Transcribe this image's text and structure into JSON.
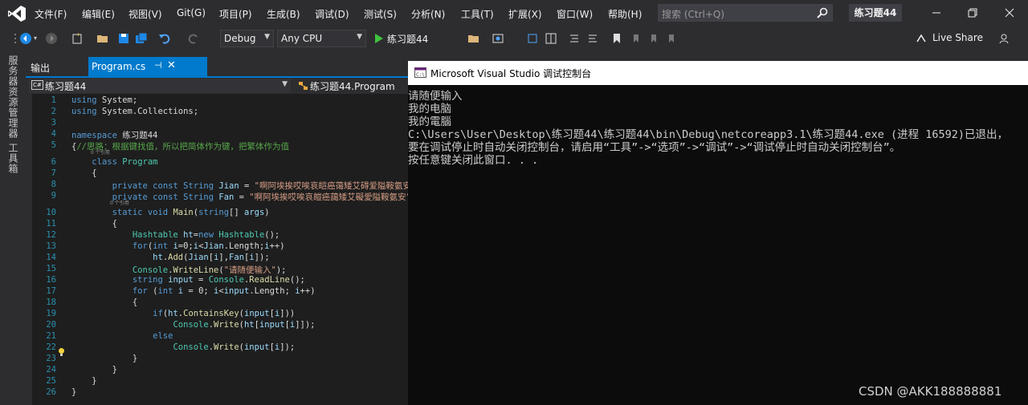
{
  "menu": [
    "文件(F)",
    "编辑(E)",
    "视图(V)",
    "Git(G)",
    "项目(P)",
    "生成(B)",
    "调试(D)",
    "测试(S)",
    "分析(N)",
    "工具(T)",
    "扩展(X)",
    "窗口(W)",
    "帮助(H)"
  ],
  "search": {
    "placeholder": "搜索 (Ctrl+Q)"
  },
  "solution_title": "练习题44",
  "toolbar": {
    "config": "Debug",
    "platform": "Any CPU",
    "run_label": "练习题44",
    "live_share": "Live Share"
  },
  "side_tools": {
    "server_explorer": "服务器资源管理器",
    "toolbox": "工具箱"
  },
  "tabs": {
    "output": "输出",
    "program": "Program.cs",
    "pin": "⊣",
    "close": "✕"
  },
  "navbar": {
    "project_icon": "C#",
    "project": "练习题44",
    "class": "练习题44.Program"
  },
  "hints": {
    "ref0": "0 个引用",
    "ref0b": "0 个引用"
  },
  "code_lines": [
    {
      "n": "1",
      "html": "<span class='kw'>using</span> System;"
    },
    {
      "n": "2",
      "html": "<span class='kw'>using</span> System.Collections;"
    },
    {
      "n": "3",
      "html": ""
    },
    {
      "n": "4",
      "html": "<span class='kw'>namespace</span> 练习题44"
    },
    {
      "n": "5",
      "html": "{<span class='cm'>//思路：根据键找值，所以把简体作为键，把繁体作为值</span>"
    },
    {
      "n": "6",
      "html": "    <span class='kw'>class</span> <span class='ty'>Program</span>"
    },
    {
      "n": "7",
      "html": "    {"
    },
    {
      "n": "8",
      "html": "        <span class='kw'>private</span> <span class='kw'>const</span> <span class='kw'>String</span> <span class='vr'>Jian</span> = <span class='str'>\"啊阿埃挨哎唉哀皑癌蔼矮艾碍爱隘鞍氨安\"</span>"
    },
    {
      "n": "9",
      "html": "        <span class='kw'>private</span> <span class='kw'>const</span> <span class='kw'>String</span> <span class='vr'>Fan</span> = <span class='str'>\"啊阿埃挨哎唉哀皚癌藹矮艾礙愛隘鞍氨安\"</span>"
    },
    {
      "n": "10",
      "html": "        <span class='kw'>static</span> <span class='kw'>void</span> <span class='mt'>Main</span>(<span class='kw'>string</span>[] <span class='vr'>args</span>)"
    },
    {
      "n": "11",
      "html": "        {"
    },
    {
      "n": "12",
      "html": "            <span class='ty'>Hashtable</span> <span class='vr'>ht</span>=<span class='kw'>new</span> <span class='ty'>Hashtable</span>();"
    },
    {
      "n": "13",
      "html": "            <span class='kw'>for</span>(<span class='kw'>int</span> <span class='vr'>i</span>=0;<span class='vr'>i</span>&lt;<span class='vr'>Jian</span>.Length;<span class='vr'>i</span>++)"
    },
    {
      "n": "14",
      "html": "                <span class='vr'>ht</span>.<span class='mt'>Add</span>(<span class='vr'>Jian</span>[<span class='vr'>i</span>],<span class='vr'>Fan</span>[<span class='vr'>i</span>]);"
    },
    {
      "n": "15",
      "html": "            <span class='ty'>Console</span>.<span class='mt'>WriteLine</span>(<span class='str'>\"请随便输入\"</span>);"
    },
    {
      "n": "16",
      "html": "            <span class='kw'>string</span> <span class='vr'>input</span> = <span class='ty'>Console</span>.<span class='mt'>ReadLine</span>();"
    },
    {
      "n": "17",
      "html": "            <span class='kw'>for</span> (<span class='kw'>int</span> <span class='vr'>i</span> = 0; <span class='vr'>i</span>&lt;<span class='vr'>input</span>.Length; <span class='vr'>i</span>++)"
    },
    {
      "n": "18",
      "html": "            {"
    },
    {
      "n": "19",
      "html": "                <span class='kw'>if</span>(<span class='vr'>ht</span>.<span class='mt'>ContainsKey</span>(<span class='vr'>input</span>[<span class='vr'>i</span>]))"
    },
    {
      "n": "20",
      "html": "                    <span class='ty'>Console</span>.<span class='mt'>Write</span>(<span class='vr'>ht</span>[<span class='vr'>input</span>[<span class='vr'>i</span>]]);"
    },
    {
      "n": "21",
      "html": "                <span class='kw'>else</span>"
    },
    {
      "n": "22",
      "html": "                    <span class='ty'>Console</span>.<span class='mt'>Write</span>(<span class='vr'>input</span>[<span class='vr'>i</span>]);"
    },
    {
      "n": "23",
      "html": "            }"
    },
    {
      "n": "24",
      "html": "        }"
    },
    {
      "n": "25",
      "html": "    }"
    },
    {
      "n": "26",
      "html": "}"
    }
  ],
  "console": {
    "title": "Microsoft Visual Studio 调试控制台",
    "lines": [
      "请随便输入",
      "我的电脑",
      "我的電腦",
      "C:\\Users\\User\\Desktop\\练习题44\\练习题44\\bin\\Debug\\netcoreapp3.1\\练习题44.exe (进程 16592)已退出，",
      "要在调试停止时自动关闭控制台，请启用“工具”->“选项”->“调试”->“调试停止时自动关闭控制台”。",
      "按任意键关闭此窗口. . ."
    ]
  },
  "watermark": "CSDN @AKK188888881",
  "colors": {
    "accent": "#007acc",
    "background": "#2d2d30",
    "editor": "#1e1e1e",
    "console": "#0c0c0c"
  }
}
